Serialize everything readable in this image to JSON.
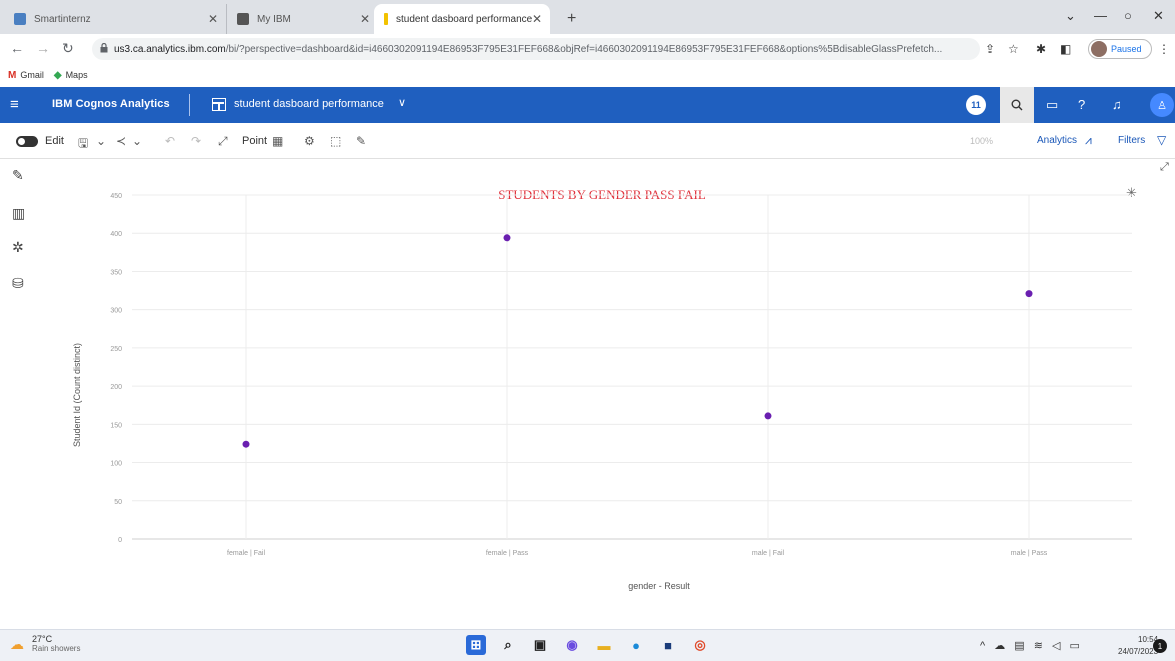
{
  "browser": {
    "tabs": [
      {
        "title": "Smartinternz",
        "favicon_color": "#4a7fc1"
      },
      {
        "title": "My IBM",
        "favicon_color": "#555555"
      },
      {
        "title": "student dasboard performance",
        "favicon_color": "#f2c200"
      }
    ],
    "new_tab_label": "+",
    "url_host": "us3.ca.analytics.ibm.com",
    "url_rest": "/bi/?perspective=dashboard&id=i4660302091194E86953F795E31FEF668&objRef=i4660302091194E86953F795E31FEF668&options%5BdisableGlassPrefetch...",
    "profile_label": "Paused",
    "bookmarks": [
      {
        "icon": "M",
        "label": "Gmail",
        "color": "#d93025"
      },
      {
        "icon": "◆",
        "label": "Maps",
        "color": "#34a853"
      }
    ]
  },
  "cognos": {
    "brand": "IBM Cognos Analytics",
    "dashboard_title": "student dasboard performance",
    "badge_count": "11"
  },
  "toolbar": {
    "edit_label": "Edit",
    "point_label": "Point",
    "zoom_label": "100%",
    "analytics_label": "Analytics",
    "filters_label": "Filters"
  },
  "chart_data": {
    "type": "scatter",
    "title": "STUDENTS BY GENDER PASS FAIL",
    "xlabel": "gender - Result",
    "ylabel": "Student Id (Count distinct)",
    "categories": [
      "female | Fail",
      "female | Pass",
      "male | Fail",
      "male | Pass"
    ],
    "values": [
      124,
      394,
      161,
      321
    ],
    "ylim": [
      0,
      450
    ],
    "yticks": [
      0,
      50,
      100,
      150,
      200,
      250,
      300,
      350,
      400,
      450
    ],
    "grid": true,
    "point_color": "#6a1fb0",
    "title_color": "#e0303a"
  },
  "taskbar": {
    "temperature": "27°C",
    "weather": "Rain showers",
    "time": "10:54",
    "date": "24/07/2023",
    "notification_count": "1"
  }
}
